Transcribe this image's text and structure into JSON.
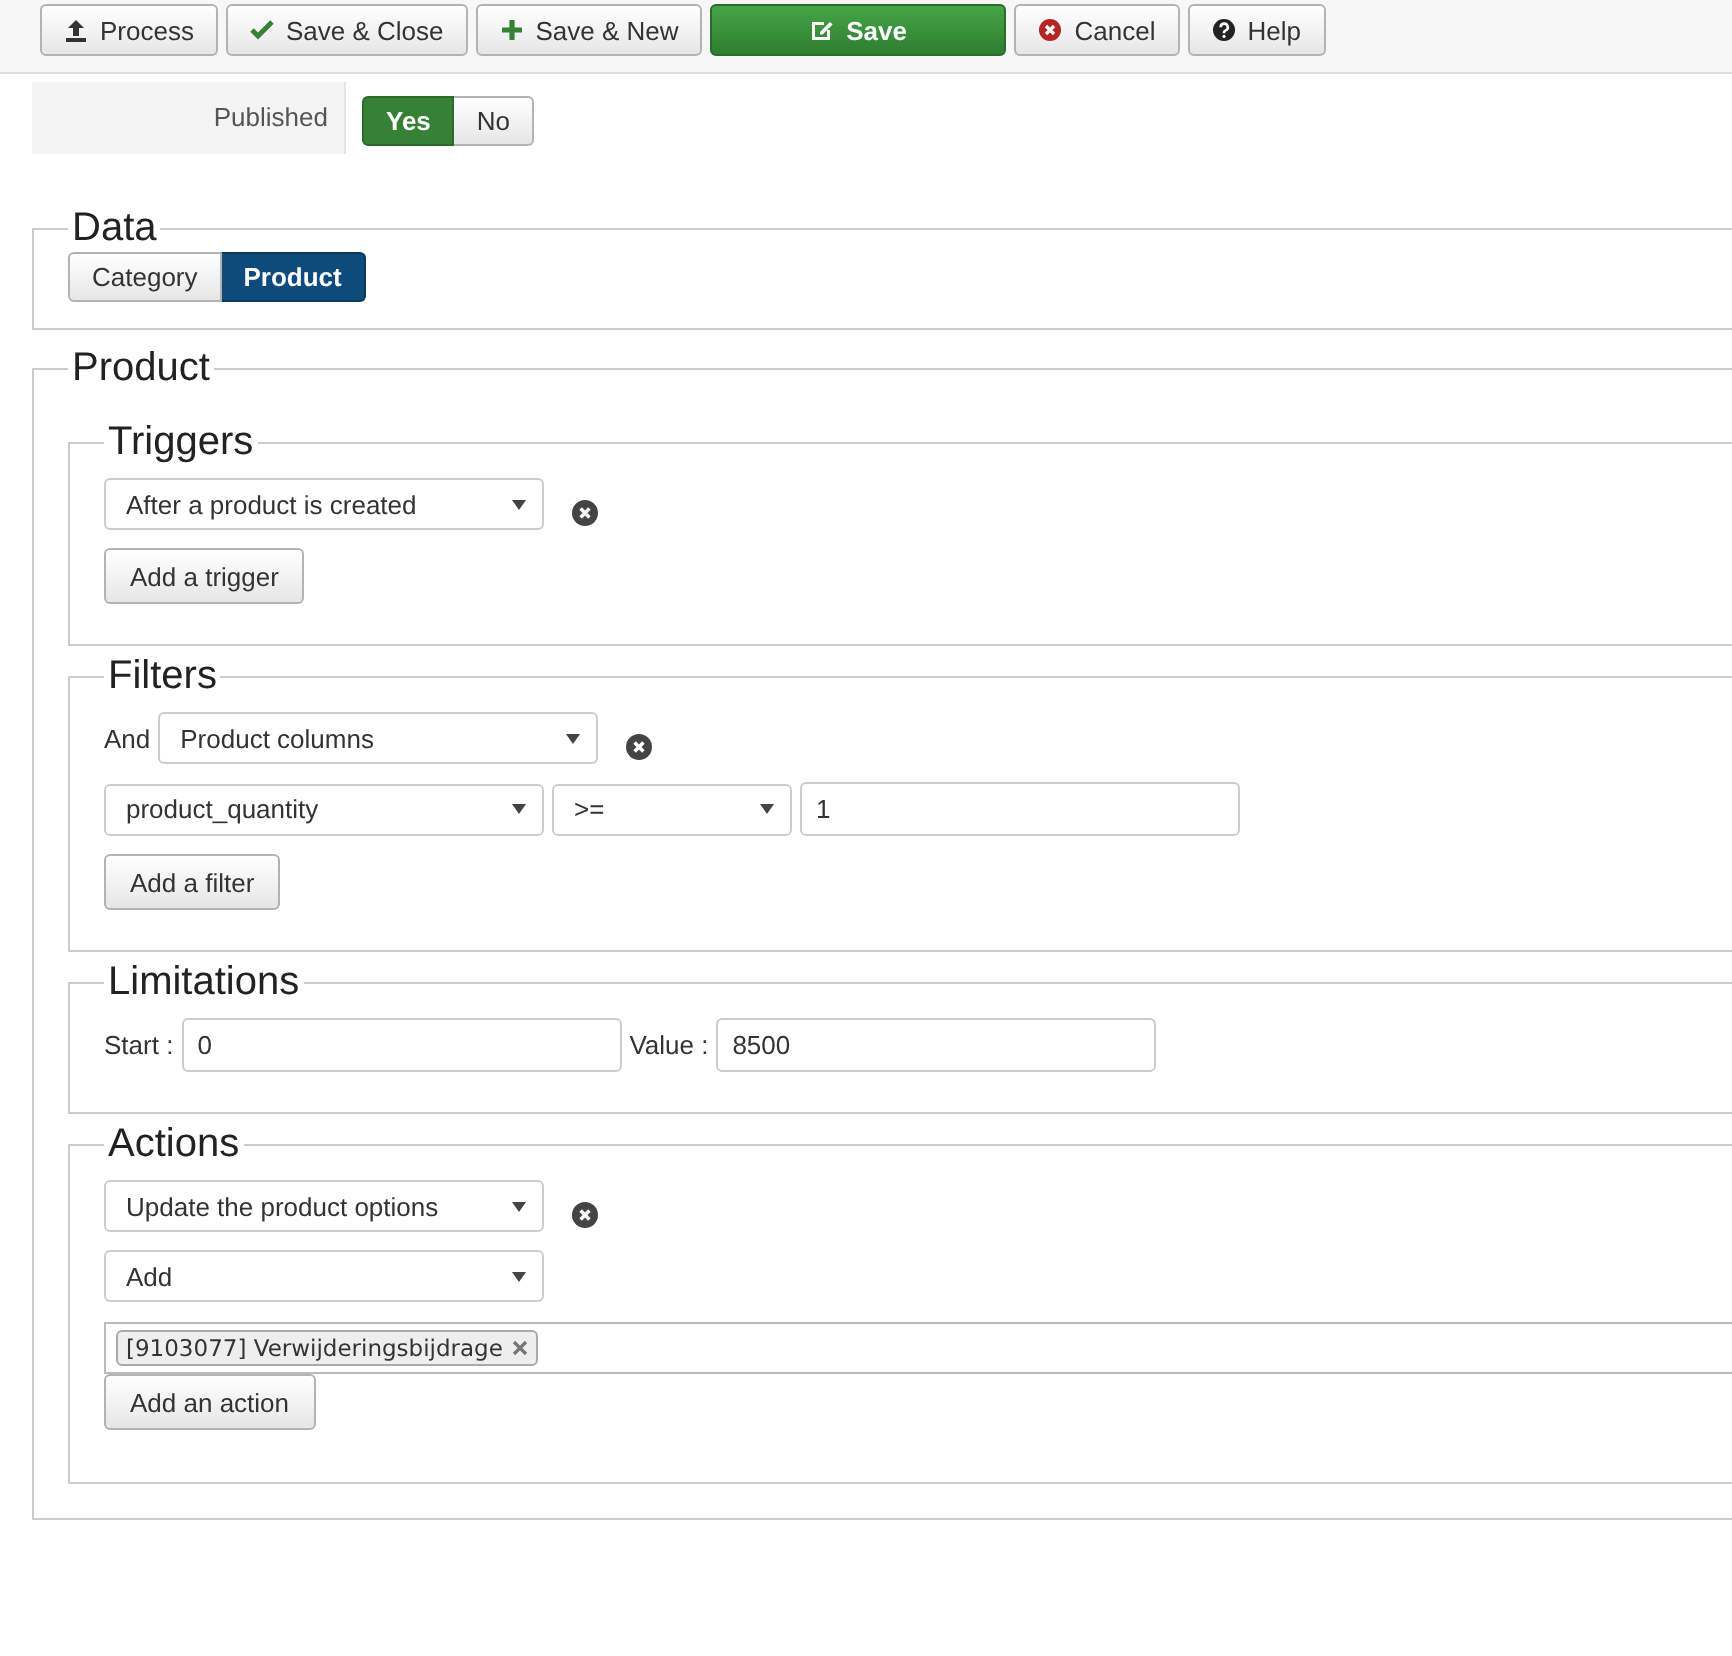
{
  "toolbar": [
    {
      "label": "Process",
      "kind": "default"
    },
    {
      "label": "Save & Close",
      "kind": "default"
    },
    {
      "label": "Save & New",
      "kind": "default"
    },
    {
      "label": "Save",
      "kind": "primary"
    },
    {
      "label": "Cancel",
      "kind": "default"
    },
    {
      "label": "Help",
      "kind": "default"
    }
  ],
  "published": {
    "label": "Published",
    "options": [
      {
        "label": "Yes",
        "selected": true
      },
      {
        "label": "No",
        "selected": false
      }
    ]
  },
  "data_section": {
    "legend": "Data",
    "options": [
      {
        "label": "Category",
        "selected": false
      },
      {
        "label": "Product",
        "selected": true
      }
    ]
  },
  "product_section": {
    "legend": "Product",
    "triggers": {
      "legend": "Triggers",
      "rows": [
        {
          "value": "After a product is created"
        }
      ],
      "button": "Add a trigger"
    },
    "filters": {
      "legend": "Filters",
      "conjunction": "And",
      "group": "Product columns",
      "column": "product_quantity",
      "operator": ">=",
      "value": "1",
      "button": "Add a filter"
    },
    "limitations": {
      "legend": "Limitations",
      "start_label": "Start :",
      "start": "0",
      "value_label": "Value :",
      "value": "8500"
    },
    "actions": {
      "legend": "Actions",
      "action": "Update the product options",
      "mode": "Add",
      "tags": [
        "[9103077] Verwijderingsbijdrage"
      ],
      "button": "Add an action"
    }
  }
}
